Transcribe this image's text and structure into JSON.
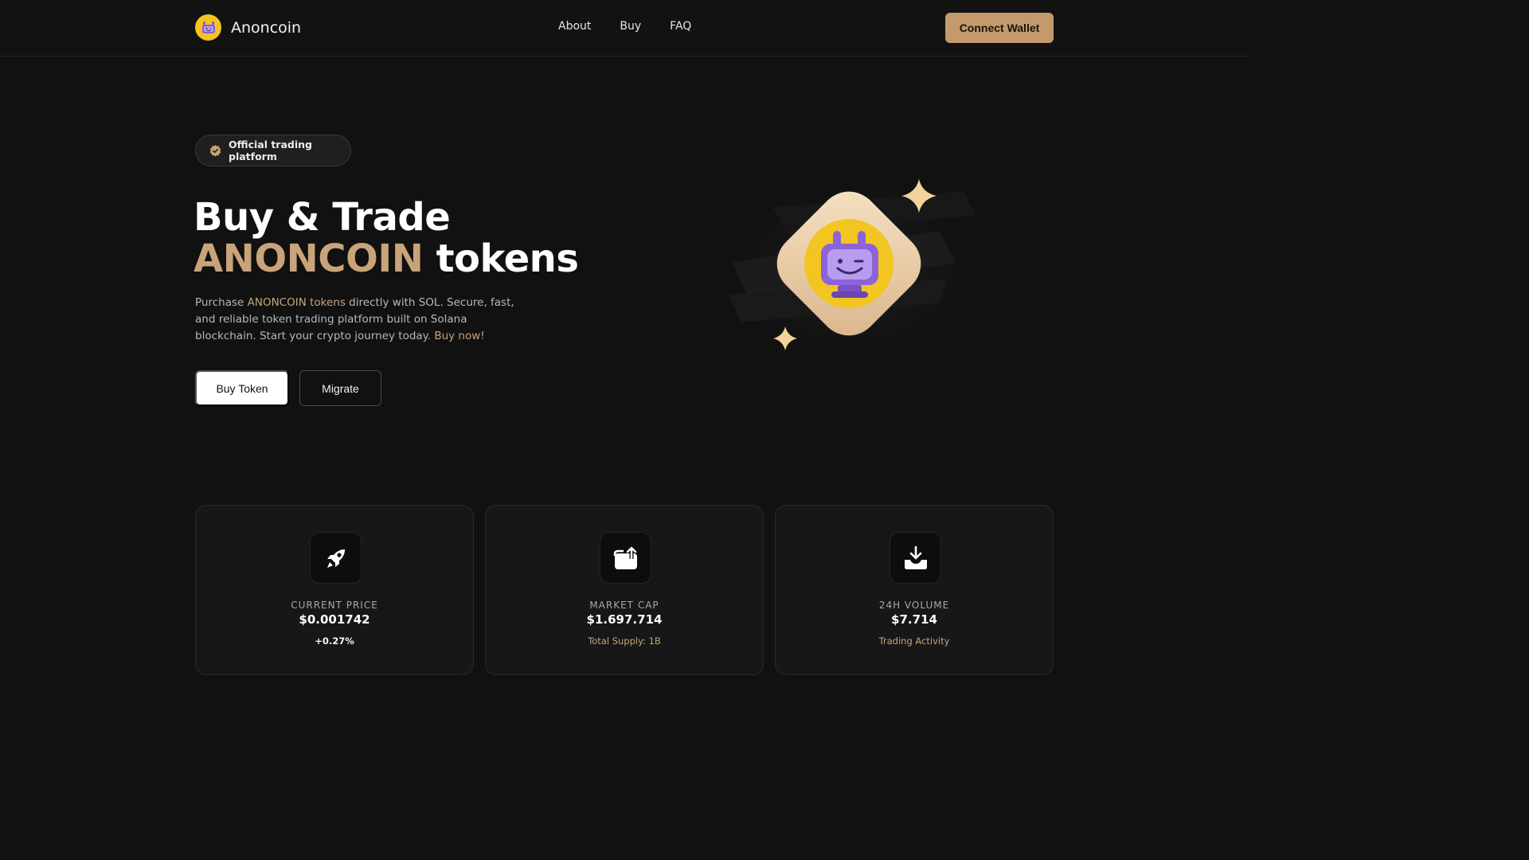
{
  "header": {
    "brand_name": "Anoncoin",
    "nav": [
      "About",
      "Buy",
      "FAQ"
    ],
    "connect_label": "Connect Wallet"
  },
  "hero": {
    "badge": "Official trading platform",
    "title_line1": "Buy & Trade",
    "title_accent": "ANONCOIN",
    "title_rest": " tokens",
    "desc_prefix": "Purchase ",
    "desc_accent": "ANONCOIN tokens",
    "desc_mid": " directly with SOL. Secure, fast, and reliable token trading platform built on Solana blockchain. Start your crypto journey today. ",
    "desc_link": "Buy now!",
    "buy_label": "Buy Token",
    "migrate_label": "Migrate"
  },
  "stats": [
    {
      "icon": "rocket-icon",
      "label": "CURRENT PRICE",
      "value": "$0.001742",
      "sub": "+0.27%"
    },
    {
      "icon": "wallet-upload-icon",
      "label": "MARKET CAP",
      "value": "$1.697.714",
      "sub": "Total Supply: 1B"
    },
    {
      "icon": "download-tray-icon",
      "label": "24H VOLUME",
      "value": "$7.714",
      "sub": "Trading Activity"
    }
  ],
  "colors": {
    "accent": "#c9a37a",
    "connect_bg": "#c49a6c",
    "background": "#111111"
  }
}
